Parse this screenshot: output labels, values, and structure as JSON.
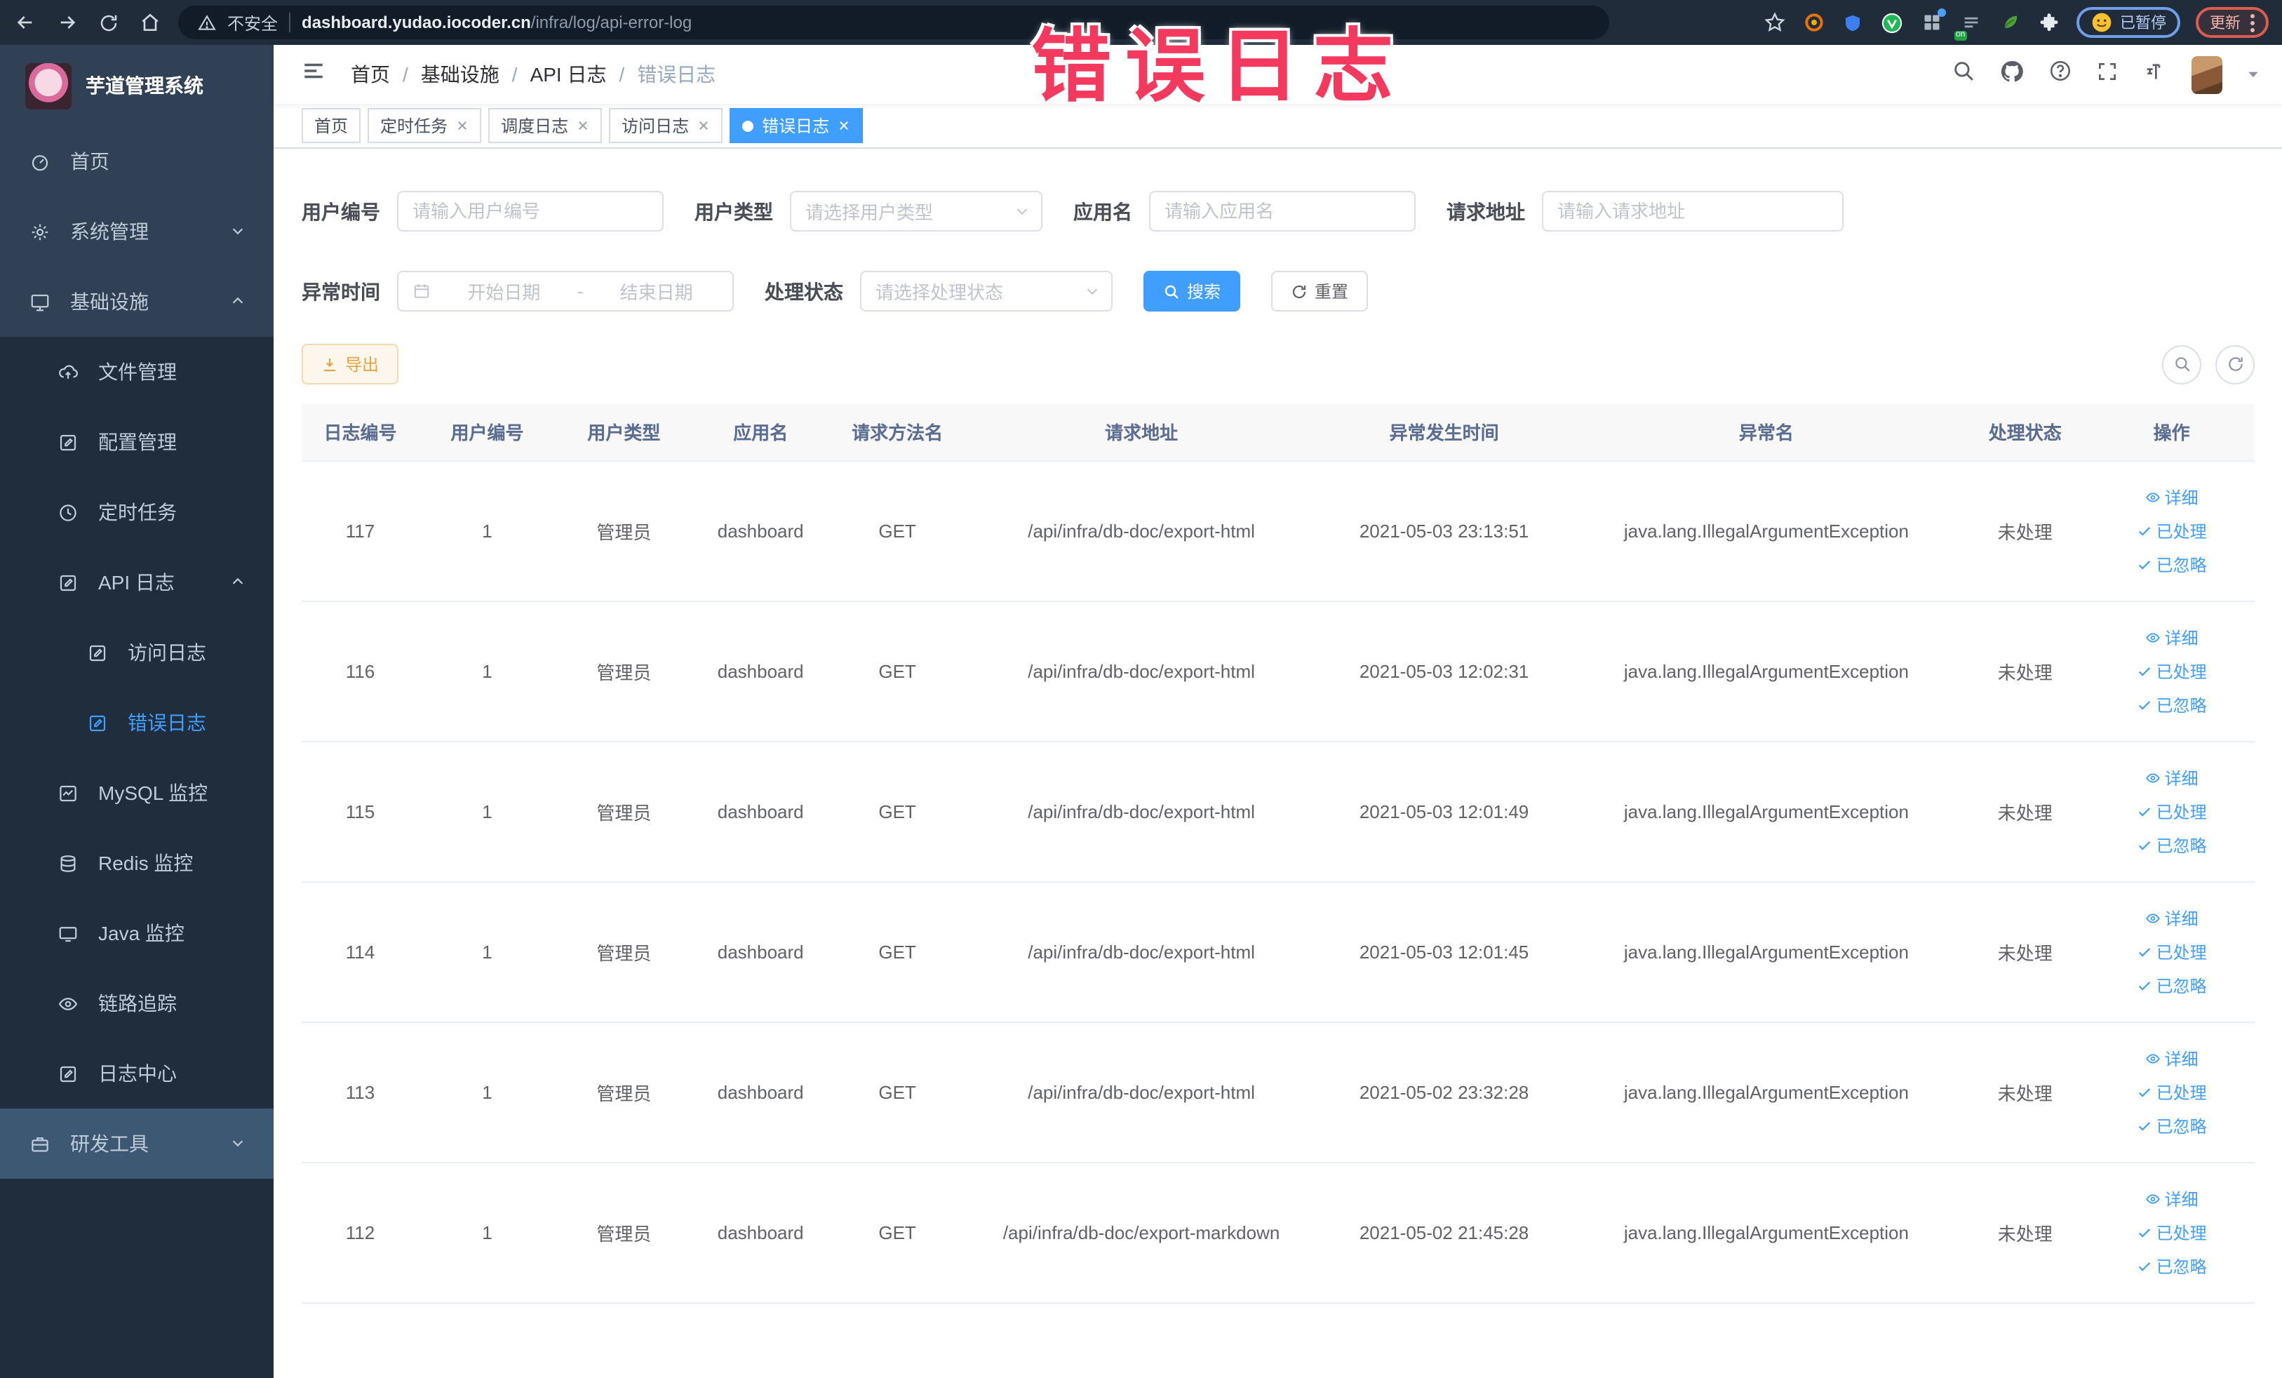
{
  "colors": {
    "accent": "#409eff",
    "warning": "#e6a23c",
    "annotation_pink": "#f4395e",
    "sidebar_bg": "#304156",
    "submenu_bg": "#1f2d3d"
  },
  "browser": {
    "security_label": "不安全",
    "url_host": "dashboard.yudao.iocoder.cn",
    "url_path": "/infra/log/api-error-log",
    "paused_badge": "已暂停",
    "update_label": "更新"
  },
  "annotation": {
    "text": "错误日志"
  },
  "sidebar": {
    "title": "芋道管理系统",
    "items": [
      {
        "label": "首页"
      },
      {
        "label": "系统管理"
      },
      {
        "label": "基础设施"
      },
      {
        "label": "文件管理"
      },
      {
        "label": "配置管理"
      },
      {
        "label": "定时任务"
      },
      {
        "label": "API 日志"
      },
      {
        "label": "访问日志"
      },
      {
        "label": "错误日志"
      },
      {
        "label": "MySQL 监控"
      },
      {
        "label": "Redis 监控"
      },
      {
        "label": "Java 监控"
      },
      {
        "label": "链路追踪"
      },
      {
        "label": "日志中心"
      },
      {
        "label": "研发工具"
      }
    ]
  },
  "breadcrumb": {
    "separator": "/",
    "items": [
      "首页",
      "基础设施",
      "API 日志",
      "错误日志"
    ]
  },
  "tabs": [
    {
      "label": "首页"
    },
    {
      "label": "定时任务"
    },
    {
      "label": "调度日志"
    },
    {
      "label": "访问日志"
    },
    {
      "label": "错误日志"
    }
  ],
  "filters": {
    "user_id": {
      "label": "用户编号",
      "placeholder": "请输入用户编号"
    },
    "user_type": {
      "label": "用户类型",
      "placeholder": "请选择用户类型"
    },
    "app_name": {
      "label": "应用名",
      "placeholder": "请输入应用名"
    },
    "request_url": {
      "label": "请求地址",
      "placeholder": "请输入请求地址"
    },
    "exception_time": {
      "label": "异常时间",
      "start_placeholder": "开始日期",
      "separator": "-",
      "end_placeholder": "结束日期"
    },
    "status": {
      "label": "处理状态",
      "placeholder": "请选择处理状态"
    },
    "search_label": "搜索",
    "reset_label": "重置"
  },
  "toolbar": {
    "export_label": "导出"
  },
  "table": {
    "columns": [
      "日志编号",
      "用户编号",
      "用户类型",
      "应用名",
      "请求方法名",
      "请求地址",
      "异常发生时间",
      "异常名",
      "处理状态",
      "操作"
    ],
    "rows": [
      {
        "id": "117",
        "user_id": "1",
        "user_type": "管理员",
        "app_name": "dashboard",
        "method": "GET",
        "url": "/api/infra/db-doc/export-html",
        "time": "2021-05-03 23:13:51",
        "exception": "java.lang.IllegalArgumentException",
        "status": "未处理"
      },
      {
        "id": "116",
        "user_id": "1",
        "user_type": "管理员",
        "app_name": "dashboard",
        "method": "GET",
        "url": "/api/infra/db-doc/export-html",
        "time": "2021-05-03 12:02:31",
        "exception": "java.lang.IllegalArgumentException",
        "status": "未处理"
      },
      {
        "id": "115",
        "user_id": "1",
        "user_type": "管理员",
        "app_name": "dashboard",
        "method": "GET",
        "url": "/api/infra/db-doc/export-html",
        "time": "2021-05-03 12:01:49",
        "exception": "java.lang.IllegalArgumentException",
        "status": "未处理"
      },
      {
        "id": "114",
        "user_id": "1",
        "user_type": "管理员",
        "app_name": "dashboard",
        "method": "GET",
        "url": "/api/infra/db-doc/export-html",
        "time": "2021-05-03 12:01:45",
        "exception": "java.lang.IllegalArgumentException",
        "status": "未处理"
      },
      {
        "id": "113",
        "user_id": "1",
        "user_type": "管理员",
        "app_name": "dashboard",
        "method": "GET",
        "url": "/api/infra/db-doc/export-html",
        "time": "2021-05-02 23:32:28",
        "exception": "java.lang.IllegalArgumentException",
        "status": "未处理"
      },
      {
        "id": "112",
        "user_id": "1",
        "user_type": "管理员",
        "app_name": "dashboard",
        "method": "GET",
        "url": "/api/infra/db-doc/export-markdown",
        "time": "2021-05-02 21:45:28",
        "exception": "java.lang.IllegalArgumentException",
        "status": "未处理"
      }
    ]
  },
  "actions": {
    "detail": "详细",
    "handled": "已处理",
    "ignored": "已忽略"
  }
}
